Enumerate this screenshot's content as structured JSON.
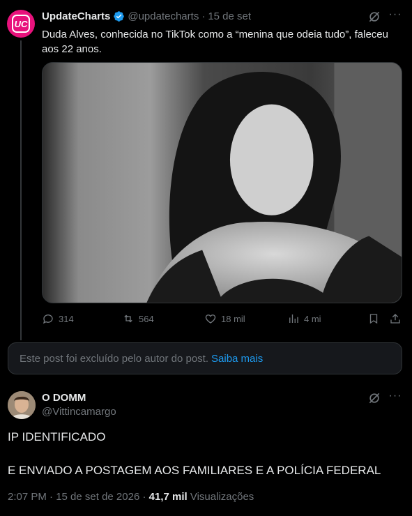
{
  "post": {
    "author_name": "UpdateCharts",
    "author_handle": "@updatecharts",
    "separator": "·",
    "date": "15 de set",
    "text": "Duda Alves, conhecida no TikTok como a “menina que odeia tudo”, faleceu aos 22 anos.",
    "replies": "314",
    "reposts": "564",
    "likes": "18 mil",
    "views": "4 mi"
  },
  "deleted_notice": {
    "text": "Este post foi excluído pelo autor do post.",
    "link": "Saiba mais"
  },
  "reply": {
    "author_name": "O DOMM",
    "author_handle": "@Vittincamargo",
    "line1": "IP IDENTIFICADO",
    "line2": "E ENVIADO A POSTAGEM AOS FAMILIARES E A POLÍCIA FEDERAL",
    "time_date": "2:07 PM · 15 de set de 2026 ·",
    "views_count": "41,7 mil",
    "views_label": "Visualizações"
  },
  "colors": {
    "background": "#000000",
    "text": "#e7e9ea",
    "muted": "#71767b",
    "accent": "#1d9bf0",
    "brand_avatar": "#e8127c"
  },
  "icons": [
    "uc-logo",
    "verified-badge-icon",
    "grok-icon",
    "more-icon",
    "reply-icon",
    "repost-icon",
    "like-icon",
    "views-icon",
    "bookmark-icon",
    "share-icon"
  ]
}
